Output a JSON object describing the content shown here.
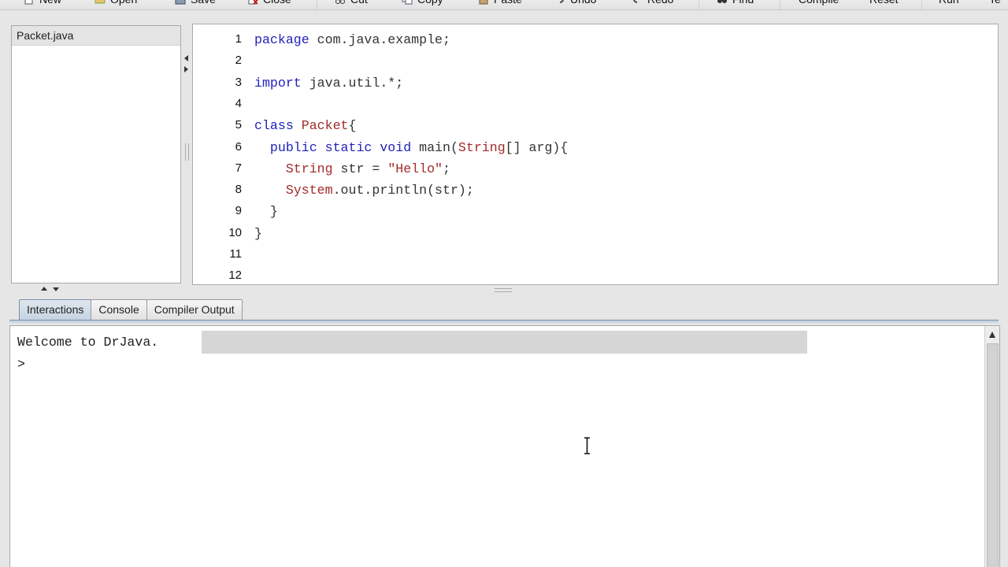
{
  "toolbar": {
    "buttons": [
      {
        "label": "New",
        "icon": "new-file-icon"
      },
      {
        "label": "Open",
        "icon": "open-folder-icon"
      },
      {
        "label": "Save",
        "icon": "save-disk-icon"
      },
      {
        "label": "Close",
        "icon": "close-file-icon"
      },
      {
        "label": "Cut",
        "icon": "scissors-icon"
      },
      {
        "label": "Copy",
        "icon": "copy-icon"
      },
      {
        "label": "Paste",
        "icon": "paste-icon"
      },
      {
        "label": "Undo",
        "icon": "undo-icon"
      },
      {
        "label": "Redo",
        "icon": "redo-icon"
      },
      {
        "label": "Find",
        "icon": "binoculars-icon"
      },
      {
        "label": "Compile",
        "icon": ""
      },
      {
        "label": "Reset",
        "icon": ""
      },
      {
        "label": "Run",
        "icon": ""
      },
      {
        "label": "Te",
        "icon": ""
      }
    ]
  },
  "files": {
    "items": [
      {
        "name": "Packet.java",
        "selected": true
      }
    ]
  },
  "editor": {
    "lines": [
      {
        "num": "1",
        "tokens": [
          {
            "t": "package",
            "c": "kw"
          },
          {
            "t": " com.java.example;",
            "c": "pl"
          }
        ]
      },
      {
        "num": "2",
        "tokens": []
      },
      {
        "num": "3",
        "tokens": [
          {
            "t": "import",
            "c": "kw"
          },
          {
            "t": " java.util.*;",
            "c": "pl"
          }
        ]
      },
      {
        "num": "4",
        "tokens": []
      },
      {
        "num": "5",
        "tokens": [
          {
            "t": "class",
            "c": "kw"
          },
          {
            "t": " ",
            "c": "pl"
          },
          {
            "t": "Packet",
            "c": "ty"
          },
          {
            "t": "{",
            "c": "pl"
          }
        ]
      },
      {
        "num": "6",
        "tokens": [
          {
            "t": "  ",
            "c": "pl"
          },
          {
            "t": "public static void",
            "c": "kw"
          },
          {
            "t": " main(",
            "c": "pl"
          },
          {
            "t": "String",
            "c": "ty"
          },
          {
            "t": "[] arg){",
            "c": "pl"
          }
        ]
      },
      {
        "num": "7",
        "tokens": [
          {
            "t": "    ",
            "c": "pl"
          },
          {
            "t": "String",
            "c": "ty"
          },
          {
            "t": " str = ",
            "c": "pl"
          },
          {
            "t": "\"Hello\"",
            "c": "st"
          },
          {
            "t": ";",
            "c": "pl"
          }
        ]
      },
      {
        "num": "8",
        "tokens": [
          {
            "t": "    ",
            "c": "pl"
          },
          {
            "t": "System",
            "c": "ty"
          },
          {
            "t": ".out.println(str);",
            "c": "pl"
          }
        ]
      },
      {
        "num": "9",
        "tokens": [
          {
            "t": "  }",
            "c": "pl"
          }
        ]
      },
      {
        "num": "10",
        "tokens": [
          {
            "t": "}",
            "c": "pl"
          }
        ]
      },
      {
        "num": "11",
        "tokens": []
      },
      {
        "num": "12",
        "tokens": []
      }
    ]
  },
  "tabs": [
    {
      "label": "Interactions",
      "active": true
    },
    {
      "label": "Console",
      "active": false
    },
    {
      "label": "Compiler Output",
      "active": false
    }
  ],
  "interactions": {
    "welcome": "Welcome to DrJava.",
    "prompt": ">"
  },
  "colors": {
    "keyword": "#2222bb",
    "type": "#a52a2a",
    "string": "#a52a2a",
    "active_tab": "#c7d3e2"
  }
}
